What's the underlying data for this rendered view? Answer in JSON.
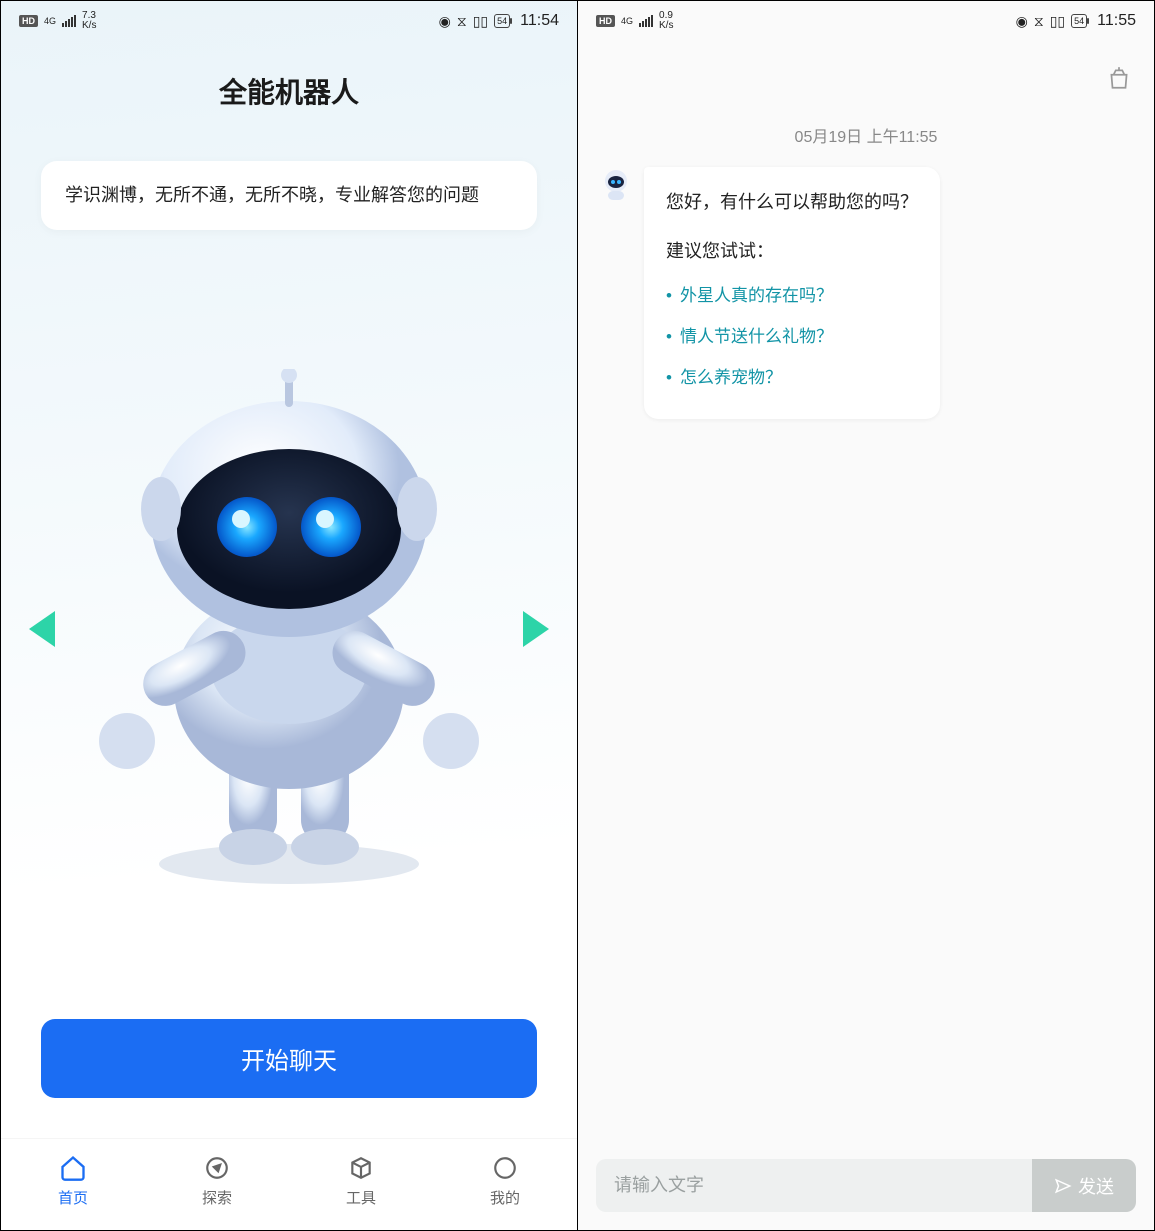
{
  "left": {
    "status": {
      "hd": "HD",
      "net": "4G",
      "speed": "7.3\nK/s",
      "battery": "54",
      "time": "11:54"
    },
    "title": "全能机器人",
    "intro": "学识渊博，无所不通，无所不晓，专业解答您的问题",
    "start_button": "开始聊天",
    "nav": {
      "home": "首页",
      "explore": "探索",
      "tools": "工具",
      "mine": "我的"
    }
  },
  "right": {
    "status": {
      "hd": "HD",
      "net": "4G",
      "speed": "0.9\nK/s",
      "battery": "54",
      "time": "11:55"
    },
    "date_stamp": "05月19日 上午11:55",
    "greeting": "您好，有什么可以帮助您的吗？",
    "suggest_title": "建议您试试：",
    "suggestions": [
      "外星人真的存在吗？",
      "情人节送什么礼物？",
      "怎么养宠物？"
    ],
    "input_placeholder": "请输入文字",
    "send_label": "发送"
  }
}
